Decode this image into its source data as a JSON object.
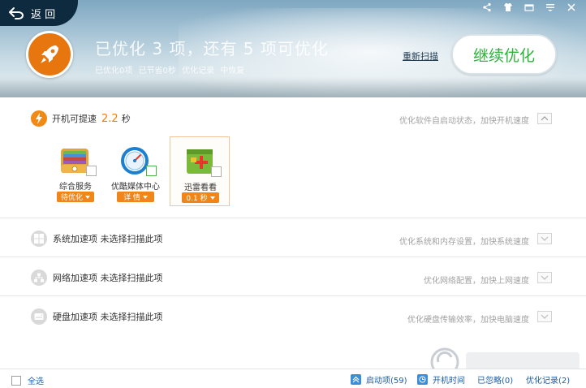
{
  "header": {
    "back_label": "返 回",
    "headline": "已优化 3 项，还有 5 项可优化",
    "sub_items": [
      "已优化0项",
      "已节省0秒",
      "优化记录",
      "中恢复"
    ],
    "rescan_label": "重新扫描",
    "continue_label": "继续优化"
  },
  "boot": {
    "label": "开机可提速",
    "time_value": "2.2",
    "time_unit": "秒",
    "hint": "优化软件自启动状态，加快开机速度",
    "apps": [
      {
        "name": "综合服务",
        "tag": "待优化"
      },
      {
        "name": "优酷媒体中心",
        "tag": "详 情"
      },
      {
        "name": "迅雷看看",
        "tag": "0.1 秒"
      }
    ]
  },
  "sections": [
    {
      "label": "系统加速项 未选择扫描此项",
      "hint": "优化系统和内存设置，加快系统速度"
    },
    {
      "label": "网络加速项 未选择扫描此项",
      "hint": "优化网络配置，加快上网速度"
    },
    {
      "label": "硬盘加速项 未选择扫描此项",
      "hint": "优化硬盘传输效率，加快电脑速度"
    }
  ],
  "footer": {
    "select_all": "全选",
    "startup_items": "启动项(59)",
    "boot_time": "开机时间",
    "ignored": "已忽略(0)",
    "history": "优化记录(2)"
  },
  "colors": {
    "accent_orange": "#f08519",
    "continue_green": "#2bb33a",
    "link_blue": "#1c5da5",
    "back_bg": "#0e2a3f"
  }
}
